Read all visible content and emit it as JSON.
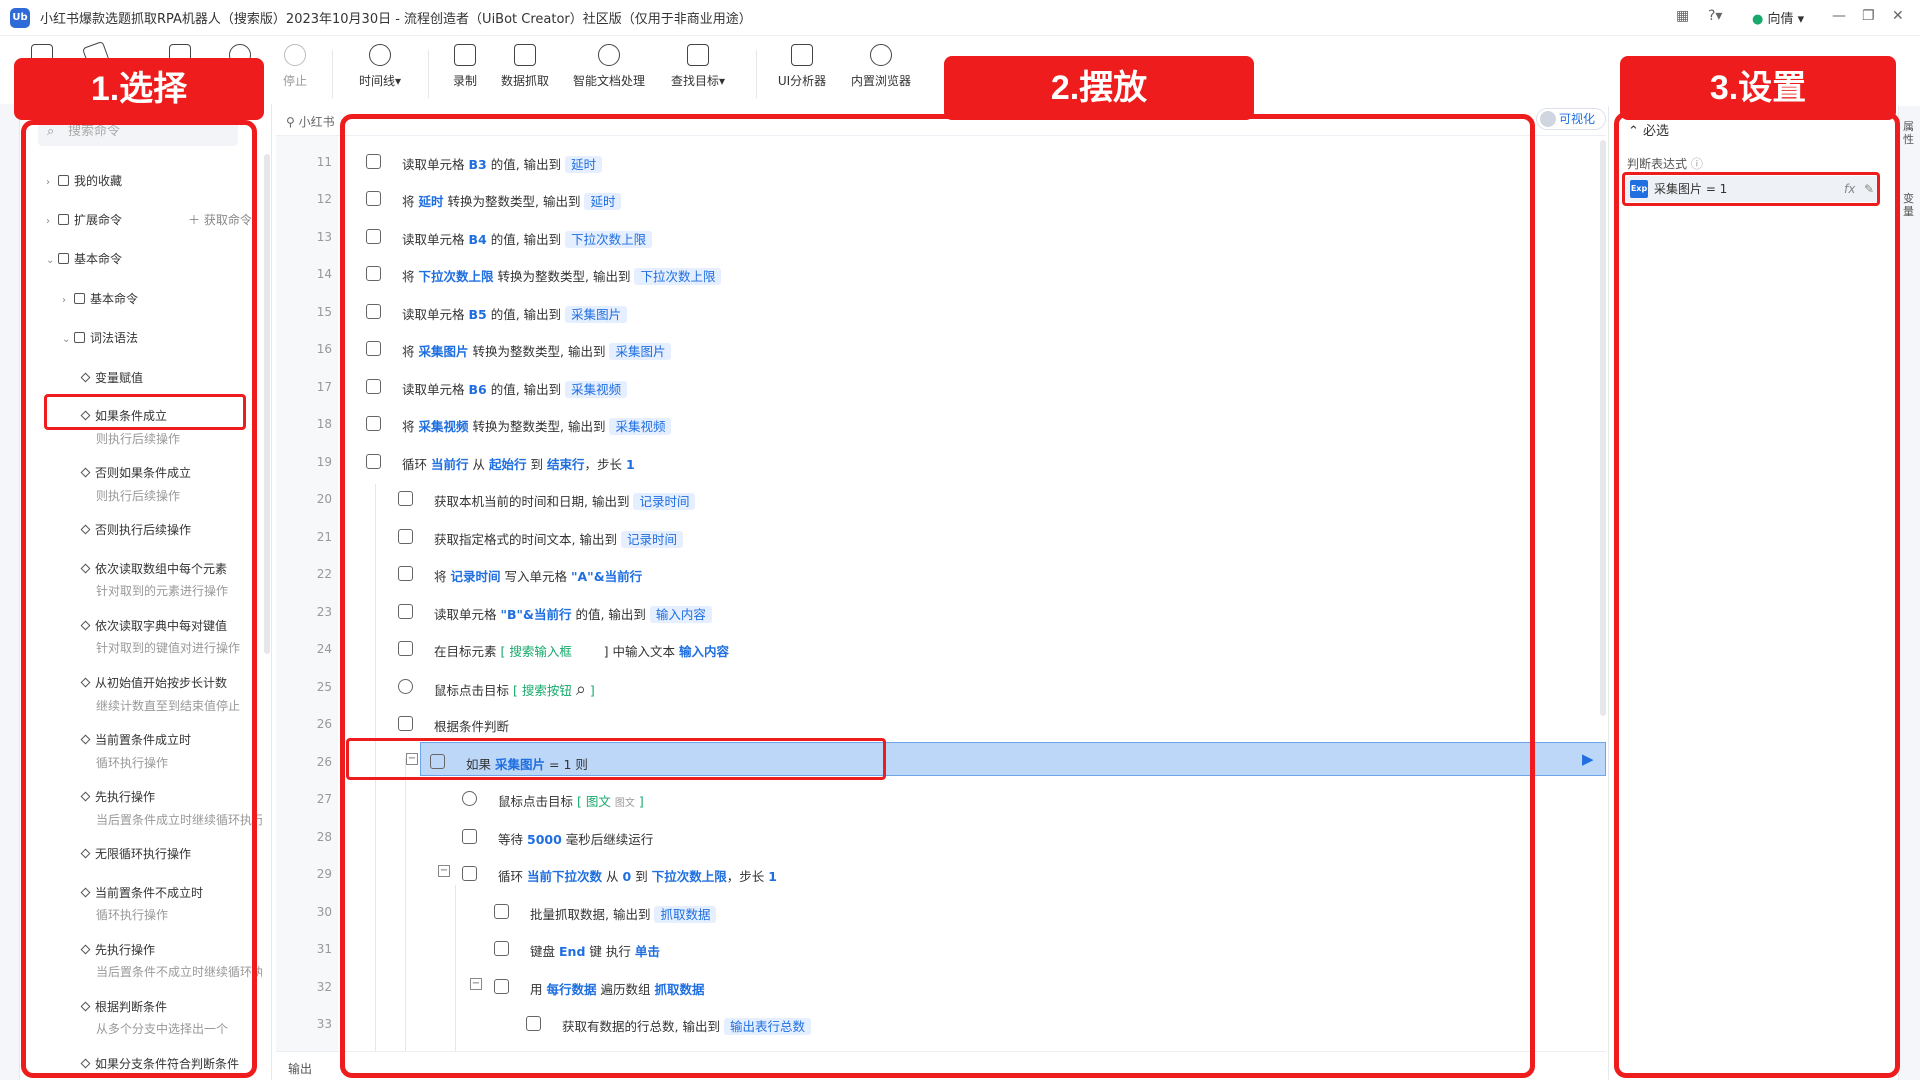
{
  "app": {
    "logo": "Ub",
    "title": "小红书爆款选题抓取RPA机器人（搜索版）2023年10月30日 - 流程创造者（UiBot Creator）社区版（仅用于非商业用途）",
    "user": "向倩",
    "user_status_color": "#17a86b"
  },
  "toolbar": {
    "stop": "停止",
    "timeline": "时间线▾",
    "record": "录制",
    "data_grab": "数据抓取",
    "smart_doc": "智能文档处理",
    "find_target": "查找目标▾",
    "ui_analyzer": "UI分析器",
    "builtin_browser": "内置浏览器"
  },
  "left_panel": {
    "search_placeholder": "搜索命令",
    "favorites": "我的收藏",
    "extensions": "扩展命令",
    "get_commands": "获取命令",
    "basic_commands_group": "基本命令",
    "basic_commands": "基本命令",
    "syntax": "词法语法",
    "commands": [
      {
        "name": "变量赋值",
        "desc": ""
      },
      {
        "name": "如果条件成立",
        "desc": "则执行后续操作"
      },
      {
        "name": "否则如果条件成立",
        "desc": "则执行后续操作"
      },
      {
        "name": "否则执行后续操作",
        "desc": ""
      },
      {
        "name": "依次读取数组中每个元素",
        "desc": "针对取到的元素进行操作"
      },
      {
        "name": "依次读取字典中每对键值",
        "desc": "针对取到的键值对进行操作"
      },
      {
        "name": "从初始值开始按步长计数",
        "desc": "继续计数直至到结束值停止"
      },
      {
        "name": "当前置条件成立时",
        "desc": "循环执行操作"
      },
      {
        "name": "先执行操作",
        "desc": "当后置条件成立时继续循环执行"
      },
      {
        "name": "无限循环执行操作",
        "desc": ""
      },
      {
        "name": "当前置条件不成立时",
        "desc": "循环执行操作"
      },
      {
        "name": "先执行操作",
        "desc": "当后置条件不成立时继续循环执行"
      },
      {
        "name": "根据判断条件",
        "desc": "从多个分支中选择出一个"
      },
      {
        "name": "如果分支条件符合判断条件",
        "desc": ""
      }
    ]
  },
  "editor": {
    "tab_breadcrumb": "小红书",
    "visualize_toggle": "可视化",
    "output_label": "输出",
    "rows": {
      "r11": {
        "ln": "11",
        "a": "读取单元格",
        "b": "B3",
        "c": "的值, 输出到",
        "d": "延时"
      },
      "r12": {
        "ln": "12",
        "a": "将",
        "b": "延时",
        "c": "转换为整数类型, 输出到",
        "d": "延时"
      },
      "r13": {
        "ln": "13",
        "a": "读取单元格",
        "b": "B4",
        "c": "的值, 输出到",
        "d": "下拉次数上限"
      },
      "r14": {
        "ln": "14",
        "a": "将",
        "b": "下拉次数上限",
        "c": "转换为整数类型, 输出到",
        "d": "下拉次数上限"
      },
      "r15": {
        "ln": "15",
        "a": "读取单元格",
        "b": "B5",
        "c": "的值, 输出到",
        "d": "采集图片"
      },
      "r16": {
        "ln": "16",
        "a": "将",
        "b": "采集图片",
        "c": "转换为整数类型, 输出到",
        "d": "采集图片"
      },
      "r17": {
        "ln": "17",
        "a": "读取单元格",
        "b": "B6",
        "c": "的值, 输出到",
        "d": "采集视频"
      },
      "r18": {
        "ln": "18",
        "a": "将",
        "b": "采集视频",
        "c": "转换为整数类型, 输出到",
        "d": "采集视频"
      },
      "r19": {
        "ln": "19",
        "a": "循环",
        "b": "当前行",
        "c": "从",
        "d": "起始行",
        "e": "到",
        "f": "结束行",
        "g": "，步长",
        "h": "1"
      },
      "r20": {
        "ln": "20",
        "a": "获取本机当前的时间和日期, 输出到",
        "d": "记录时间"
      },
      "r21": {
        "ln": "21",
        "a": "获取指定格式的时间文本, 输出到",
        "d": "记录时间"
      },
      "r22": {
        "ln": "22",
        "a": "将",
        "b": "记录时间",
        "c": "写入单元格",
        "d": "\"A\"&当前行"
      },
      "r23": {
        "ln": "23",
        "a": "读取单元格",
        "b": "\"B\"&当前行",
        "c": "的值, 输出到",
        "d": "输入内容"
      },
      "r24": {
        "ln": "24",
        "a": "在目标元素",
        "b": "[ 搜索输入框",
        "c": "] 中输入文本",
        "d": "输入内容"
      },
      "r25": {
        "ln": "25",
        "a": "鼠标点击目标",
        "b": "[ 搜索按钮",
        "c": "]"
      },
      "r26a": {
        "ln": "26",
        "a": "根据条件判断"
      },
      "r26b": {
        "ln": "26",
        "a": "如果",
        "b": "采集图片",
        "c": "= 1 则"
      },
      "r27": {
        "ln": "27",
        "a": "鼠标点击目标",
        "b": "[ 图文",
        "sm": "图文",
        "c": "]"
      },
      "r28": {
        "ln": "28",
        "a": "等待",
        "b": "5000",
        "c": "毫秒后继续运行"
      },
      "r29": {
        "ln": "29",
        "a": "循环",
        "b": "当前下拉次数",
        "c": "从",
        "d": "0",
        "e": "到",
        "f": "下拉次数上限",
        "g": "，步长",
        "h": "1"
      },
      "r30": {
        "ln": "30",
        "a": "批量抓取数据, 输出到",
        "d": "抓取数据"
      },
      "r31": {
        "ln": "31",
        "a": "键盘",
        "b": "End",
        "c": "键 执行",
        "d": "单击"
      },
      "r32": {
        "ln": "32",
        "a": "用",
        "b": "每行数据",
        "c": "遍历数组",
        "d": "抓取数据"
      },
      "r33": {
        "ln": "33",
        "a": "获取有数据的行总数, 输出到",
        "d": "输出表行总数"
      }
    }
  },
  "right_panel": {
    "section": "必选",
    "field_label": "判断表达式",
    "expr_badge": "Exp",
    "expression": "采集图片 = 1",
    "fx": "fx",
    "rail_top": "属性",
    "rail_bottom": "变量"
  },
  "overlays": {
    "label1": "1.选择",
    "label2": "2.摆放",
    "label3": "3.设置",
    "color": "#ee1c1c"
  }
}
